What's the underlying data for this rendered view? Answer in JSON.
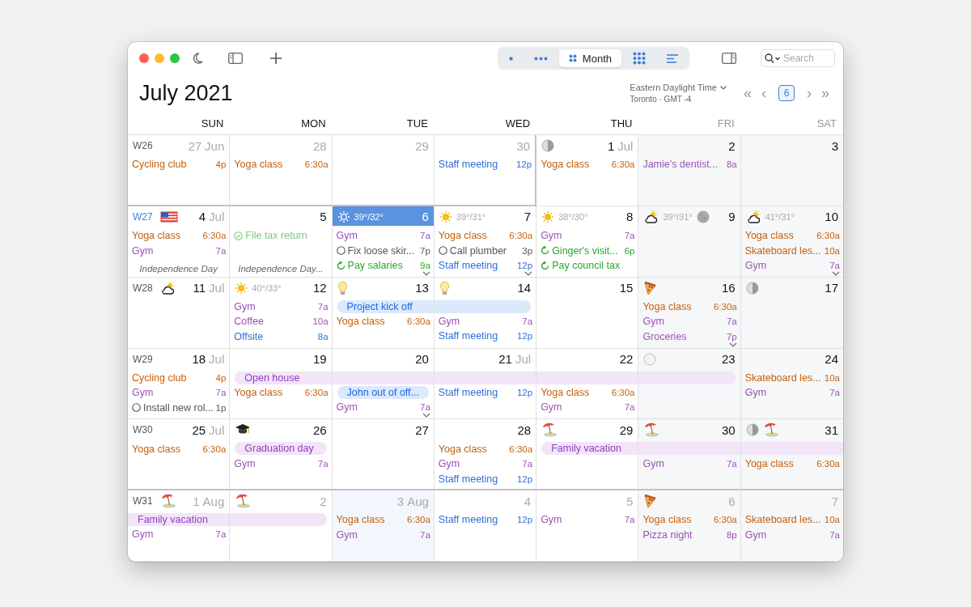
{
  "toolbar": {
    "views": [
      {
        "kind": "day",
        "selected": false
      },
      {
        "kind": "week",
        "selected": false
      },
      {
        "kind": "month",
        "label": "Month",
        "selected": true
      },
      {
        "kind": "year",
        "selected": false
      },
      {
        "kind": "list",
        "selected": false
      }
    ],
    "search": {
      "placeholder": "Search"
    }
  },
  "title": "**July** 2021",
  "timezone": {
    "name": "Eastern Daylight Time",
    "detail": "Toronto · GMT -4"
  },
  "navigation": {
    "first": "«",
    "prev": "‹",
    "today": "6",
    "next": "›",
    "last": "»"
  },
  "columns": [
    {
      "label": "SUN",
      "weekend": false
    },
    {
      "label": "MON",
      "weekend": false
    },
    {
      "label": "TUE",
      "weekend": false
    },
    {
      "label": "WED",
      "weekend": false
    },
    {
      "label": "THU",
      "weekend": false
    },
    {
      "label": "FRI",
      "weekend": true
    },
    {
      "label": "SAT",
      "weekend": true
    }
  ],
  "weeks": [
    {
      "week": "W26",
      "current": false,
      "days": [
        {
          "date": "27",
          "month": "Jun",
          "in_month": false,
          "events": [
            {
              "kind": "timed",
              "title": "Cycling club",
              "time": "4p",
              "color": "#c4600c"
            }
          ]
        },
        {
          "date": "28",
          "in_month": false,
          "events": [
            {
              "kind": "timed",
              "title": "Yoga class",
              "time": "6:30a",
              "color": "#c4600c"
            }
          ]
        },
        {
          "date": "29",
          "in_month": false
        },
        {
          "date": "30",
          "in_month": false,
          "events": [
            {
              "kind": "timed",
              "title": "Staff meeting",
              "time": "12p",
              "color": "#2f6fd6"
            }
          ]
        },
        {
          "date": "1",
          "month": "Jul",
          "in_month": true,
          "badges": [
            {
              "kind": "half-moon"
            }
          ],
          "events": [
            {
              "kind": "timed",
              "title": "Yoga class",
              "time": "6:30a",
              "color": "#c4600c"
            }
          ]
        },
        {
          "date": "2",
          "in_month": true,
          "events": [
            {
              "kind": "timed",
              "title": "Jamie's dentist...",
              "time": "8a",
              "color": "#9a52b4"
            }
          ]
        },
        {
          "date": "3",
          "in_month": true
        }
      ]
    },
    {
      "week": "W27",
      "current": true,
      "days": [
        {
          "date": "4",
          "month": "Jul",
          "in_month": true,
          "badges": [
            {
              "kind": "flag"
            }
          ],
          "events": [
            {
              "kind": "timed",
              "title": "Yoga class",
              "time": "6:30a",
              "color": "#c4600c"
            },
            {
              "kind": "timed",
              "title": "Gym",
              "time": "7a",
              "color": "#9a52b4"
            },
            {
              "kind": "holiday",
              "title": "Independence Day"
            }
          ]
        },
        {
          "date": "5",
          "in_month": true,
          "events": [
            {
              "kind": "task",
              "title": "File tax return",
              "done": true,
              "color": "#7cc97c"
            },
            {
              "kind": "holiday",
              "title": "Independence Day..."
            }
          ]
        },
        {
          "date": "6",
          "in_month": true,
          "selected": true,
          "more": true,
          "weather": {
            "kind": "sun",
            "temp": "39°/32°"
          },
          "events": [
            {
              "kind": "timed",
              "title": "Gym",
              "time": "7a",
              "color": "#9a52b4"
            },
            {
              "kind": "task",
              "title": "Fix loose skir...",
              "time": "7p",
              "done": false,
              "color": "#555555"
            },
            {
              "kind": "recurring",
              "title": "Pay salaries",
              "time": "9a",
              "color": "#2ea32e"
            }
          ]
        },
        {
          "date": "7",
          "in_month": true,
          "more": true,
          "weather": {
            "kind": "sun",
            "temp": "39°/31°"
          },
          "events": [
            {
              "kind": "timed",
              "title": "Yoga class",
              "time": "6:30a",
              "color": "#c4600c"
            },
            {
              "kind": "task",
              "title": "Call plumber",
              "time": "3p",
              "done": false,
              "color": "#555555"
            },
            {
              "kind": "timed",
              "title": "Staff meeting",
              "time": "12p",
              "color": "#2f6fd6"
            }
          ]
        },
        {
          "date": "8",
          "in_month": true,
          "weather": {
            "kind": "sun",
            "temp": "38°/30°"
          },
          "events": [
            {
              "kind": "timed",
              "title": "Gym",
              "time": "7a",
              "color": "#9a52b4"
            },
            {
              "kind": "recurring",
              "title": "Ginger's visit...",
              "time": "6p",
              "color": "#2ea32e"
            },
            {
              "kind": "recurring",
              "title": "Pay council tax",
              "color": "#2ea32e"
            }
          ]
        },
        {
          "date": "9",
          "in_month": true,
          "weather": {
            "kind": "cloud-sun",
            "temp": "39°/31°"
          },
          "badges": [
            {
              "kind": "full-moon"
            }
          ]
        },
        {
          "date": "10",
          "in_month": true,
          "more": true,
          "weather": {
            "kind": "cloud-sun",
            "temp": "41°/31°"
          },
          "events": [
            {
              "kind": "timed",
              "title": "Yoga class",
              "time": "6:30a",
              "color": "#c4600c"
            },
            {
              "kind": "timed",
              "title": "Skateboard les...",
              "time": "10a",
              "color": "#c4600c"
            },
            {
              "kind": "timed",
              "title": "Gym",
              "time": "7a",
              "color": "#9a52b4"
            }
          ]
        }
      ]
    },
    {
      "week": "W28",
      "current": false,
      "days": [
        {
          "date": "11",
          "month": "Jul",
          "in_month": true,
          "weather": {
            "kind": "cloud-sun"
          }
        },
        {
          "date": "12",
          "in_month": true,
          "weather": {
            "kind": "sun",
            "temp": "40°/33°"
          },
          "events": [
            {
              "kind": "timed",
              "title": "Gym",
              "time": "7a",
              "color": "#9a52b4"
            },
            {
              "kind": "timed",
              "title": "Coffee",
              "time": "10a",
              "color": "#9a52b4"
            },
            {
              "kind": "timed",
              "title": "Offsite",
              "time": "8a",
              "color": "#2f6fd6"
            }
          ]
        },
        {
          "date": "13",
          "in_month": true,
          "badges": [
            {
              "kind": "bulb"
            }
          ],
          "events": [
            {
              "kind": "band-start",
              "title": "Project kick off",
              "color": "#dce8fb"
            },
            {
              "kind": "timed",
              "title": "Yoga class",
              "time": "6:30a",
              "color": "#c4600c"
            }
          ]
        },
        {
          "date": "14",
          "in_month": true,
          "badges": [
            {
              "kind": "bulb"
            }
          ],
          "events": [
            {
              "kind": "band-end",
              "color": "#dce8fb"
            },
            {
              "kind": "timed",
              "title": "Gym",
              "time": "7a",
              "color": "#9a52b4"
            },
            {
              "kind": "timed",
              "title": "Staff meeting",
              "time": "12p",
              "color": "#2f6fd6"
            }
          ]
        },
        {
          "date": "15",
          "in_month": true
        },
        {
          "date": "16",
          "in_month": true,
          "more": true,
          "badges": [
            {
              "kind": "pizza"
            }
          ],
          "events": [
            {
              "kind": "timed",
              "title": "Yoga class",
              "time": "6:30a",
              "color": "#c4600c"
            },
            {
              "kind": "timed",
              "title": "Gym",
              "time": "7a",
              "color": "#9a52b4"
            },
            {
              "kind": "timed",
              "title": "Groceries",
              "time": "7p",
              "color": "#9a52b4"
            }
          ]
        },
        {
          "date": "17",
          "in_month": true,
          "badges": [
            {
              "kind": "half-moon"
            }
          ]
        }
      ]
    },
    {
      "week": "W29",
      "current": false,
      "days": [
        {
          "date": "18",
          "month": "Jul",
          "in_month": true,
          "events": [
            {
              "kind": "timed",
              "title": "Cycling club",
              "time": "4p",
              "color": "#c4600c"
            },
            {
              "kind": "timed",
              "title": "Gym",
              "time": "7a",
              "color": "#9a52b4"
            },
            {
              "kind": "task",
              "title": "Install new rol...",
              "time": "1p",
              "done": false,
              "color": "#555555"
            }
          ]
        },
        {
          "date": "19",
          "in_month": true,
          "events": [
            {
              "kind": "band-start",
              "title": "Open house",
              "color": "#f1e5f7"
            },
            {
              "kind": "timed",
              "title": "Yoga class",
              "time": "6:30a",
              "color": "#c4600c"
            }
          ]
        },
        {
          "date": "20",
          "in_month": true,
          "more": true,
          "events": [
            {
              "kind": "band-middle",
              "color": "#f1e5f7"
            },
            {
              "kind": "band-single",
              "title": "John out of off...",
              "color": "#dce8fb"
            },
            {
              "kind": "timed",
              "title": "Gym",
              "time": "7a",
              "color": "#9a52b4"
            }
          ]
        },
        {
          "date": "21",
          "month": "Jul",
          "in_month": true,
          "events": [
            {
              "kind": "band-middle",
              "color": "#f1e5f7"
            },
            {
              "kind": "timed",
              "title": "Staff meeting",
              "time": "12p",
              "color": "#2f6fd6"
            }
          ]
        },
        {
          "date": "22",
          "in_month": true,
          "events": [
            {
              "kind": "band-middle",
              "color": "#f1e5f7"
            },
            {
              "kind": "timed",
              "title": "Yoga class",
              "time": "6:30a",
              "color": "#c4600c"
            },
            {
              "kind": "timed",
              "title": "Gym",
              "time": "7a",
              "color": "#9a52b4"
            }
          ]
        },
        {
          "date": "23",
          "in_month": true,
          "badges": [
            {
              "kind": "pale-moon"
            }
          ],
          "events": [
            {
              "kind": "band-end",
              "color": "#f1e5f7"
            }
          ]
        },
        {
          "date": "24",
          "in_month": true,
          "events": [
            {
              "kind": "timed",
              "title": "Skateboard les...",
              "time": "10a",
              "color": "#c4600c"
            },
            {
              "kind": "timed",
              "title": "Gym",
              "time": "7a",
              "color": "#9a52b4"
            }
          ]
        }
      ]
    },
    {
      "week": "W30",
      "current": false,
      "days": [
        {
          "date": "25",
          "month": "Jul",
          "in_month": true,
          "events": [
            {
              "kind": "timed",
              "title": "Yoga class",
              "time": "6:30a",
              "color": "#c4600c"
            }
          ]
        },
        {
          "date": "26",
          "in_month": true,
          "badges": [
            {
              "kind": "grad-cap"
            }
          ],
          "events": [
            {
              "kind": "band-single",
              "title": "Graduation day",
              "color": "#f1e5f7"
            },
            {
              "kind": "timed",
              "title": "Gym",
              "time": "7a",
              "color": "#9a52b4"
            }
          ]
        },
        {
          "date": "27",
          "in_month": true
        },
        {
          "date": "28",
          "in_month": true,
          "events": [
            {
              "kind": "timed",
              "title": "Yoga class",
              "time": "6:30a",
              "color": "#c4600c"
            },
            {
              "kind": "timed",
              "title": "Gym",
              "time": "7a",
              "color": "#9a52b4"
            },
            {
              "kind": "timed",
              "title": "Staff meeting",
              "time": "12p",
              "color": "#2f6fd6"
            }
          ]
        },
        {
          "date": "29",
          "in_month": true,
          "badges": [
            {
              "kind": "beach"
            }
          ],
          "events": [
            {
              "kind": "band-start",
              "title": "Family vacation",
              "color": "#f1e5f7"
            }
          ]
        },
        {
          "date": "30",
          "in_month": true,
          "badges": [
            {
              "kind": "beach"
            }
          ],
          "events": [
            {
              "kind": "band-middle",
              "color": "#f1e5f7"
            },
            {
              "kind": "timed",
              "title": "Gym",
              "time": "7a",
              "color": "#9a52b4"
            }
          ]
        },
        {
          "date": "31",
          "in_month": true,
          "badges": [
            {
              "kind": "half-moon"
            },
            {
              "kind": "beach"
            }
          ],
          "events": [
            {
              "kind": "band-middle",
              "color": "#f1e5f7"
            },
            {
              "kind": "timed",
              "title": "Yoga class",
              "time": "6:30a",
              "color": "#c4600c"
            }
          ]
        }
      ]
    },
    {
      "week": "W31",
      "current": false,
      "days": [
        {
          "date": "1",
          "month": "Aug",
          "in_month": false,
          "badges": [
            {
              "kind": "beach"
            }
          ],
          "events": [
            {
              "kind": "band-middle",
              "title": "Family vacation",
              "color": "#f1e5f7"
            },
            {
              "kind": "timed",
              "title": "Gym",
              "time": "7a",
              "color": "#9a52b4"
            }
          ]
        },
        {
          "date": "2",
          "in_month": false,
          "badges": [
            {
              "kind": "beach"
            }
          ],
          "events": [
            {
              "kind": "band-end",
              "color": "#f1e5f7"
            }
          ]
        },
        {
          "date": "3",
          "month": "Aug",
          "in_month": false,
          "highlighted": true,
          "events": [
            {
              "kind": "timed",
              "title": "Yoga class",
              "time": "6:30a",
              "color": "#c4600c"
            },
            {
              "kind": "timed",
              "title": "Gym",
              "time": "7a",
              "color": "#9a52b4"
            }
          ]
        },
        {
          "date": "4",
          "in_month": false,
          "events": [
            {
              "kind": "timed",
              "title": "Staff meeting",
              "time": "12p",
              "color": "#2f6fd6"
            }
          ]
        },
        {
          "date": "5",
          "in_month": false,
          "events": [
            {
              "kind": "timed",
              "title": "Gym",
              "time": "7a",
              "color": "#9a52b4"
            }
          ]
        },
        {
          "date": "6",
          "in_month": false,
          "badges": [
            {
              "kind": "pizza"
            }
          ],
          "events": [
            {
              "kind": "timed",
              "title": "Yoga class",
              "time": "6:30a",
              "color": "#c4600c"
            },
            {
              "kind": "timed",
              "title": "Pizza night",
              "time": "8p",
              "color": "#9a52b4"
            }
          ]
        },
        {
          "date": "7",
          "in_month": false,
          "events": [
            {
              "kind": "timed",
              "title": "Skateboard les...",
              "time": "10a",
              "color": "#c4600c"
            },
            {
              "kind": "timed",
              "title": "Gym",
              "time": "7a",
              "color": "#9a52b4"
            }
          ]
        }
      ]
    }
  ]
}
